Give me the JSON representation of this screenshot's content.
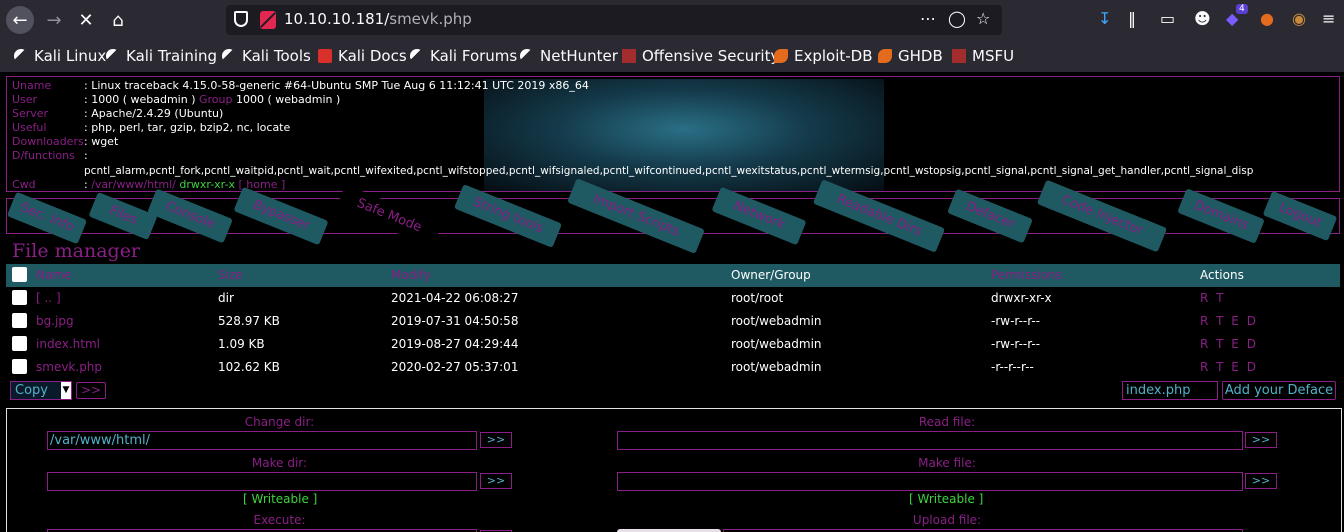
{
  "browser": {
    "url_host": "10.10.10.181/",
    "url_path": "smevk.php",
    "badge_count": "4",
    "bookmarks": [
      "Kali Linux",
      "Kali Training",
      "Kali Tools",
      "Kali Docs",
      "Kali Forums",
      "NetHunter",
      "Offensive Security",
      "Exploit-DB",
      "GHDB",
      "MSFU"
    ]
  },
  "info": {
    "uname_label": "Uname",
    "uname": ": Linux traceback 4.15.0-58-generic #64-Ubuntu SMP Tue Aug 6 11:12:41 UTC 2019 x86_64",
    "user_label": "User",
    "user": ": 1000 ( webadmin )",
    "group_label": "Group",
    "group": "1000 ( webadmin )",
    "server_label": "Server",
    "server": ": Apache/2.4.29 (Ubuntu)",
    "useful_label": "Useful",
    "useful": ": php, perl, tar, gzip, bzip2, nc, locate",
    "downloaders_label": "Downloaders",
    "downloaders": ": wget",
    "dfunctions_label": "D/functions",
    "dfunctions_colon": ":",
    "dfunctions": "pcntl_alarm,pcntl_fork,pcntl_waitpid,pcntl_wait,pcntl_wifexited,pcntl_wifstopped,pcntl_wifsignaled,pcntl_wifcontinued,pcntl_wexitstatus,pcntl_wtermsig,pcntl_wstopsig,pcntl_signal,pcntl_signal_get_handler,pcntl_signal_disp",
    "cwd_label": "Cwd",
    "cwd_colon": ":",
    "cwd_path": "/var/www/html/",
    "cwd_perm": "drwxr-xr-x",
    "cwd_home": "[ home ]"
  },
  "menu": [
    "Sec. Info",
    "Files",
    "Console",
    "Bypasser",
    "Safe Mode",
    "String tools",
    "Import Scripts",
    "Network",
    "Readable Dirs",
    "Defacer",
    "Code Injector",
    "Domains",
    "Logout"
  ],
  "file_manager": {
    "title": "File manager",
    "columns": [
      "Name",
      "Size",
      "Modify",
      "Owner/Group",
      "Permissions",
      "Actions"
    ],
    "rows": [
      {
        "name": "[ .. ]",
        "size": "dir",
        "modify": "2021-04-22 06:08:27",
        "owner": "root/root",
        "perms": "drwxr-xr-x",
        "actions": "R T"
      },
      {
        "name": "bg.jpg",
        "size": "528.97 KB",
        "modify": "2019-07-31 04:50:58",
        "owner": "root/webadmin",
        "perms": "-rw-r--r--",
        "actions": "R T E D"
      },
      {
        "name": "index.html",
        "size": "1.09 KB",
        "modify": "2019-08-27 04:29:44",
        "owner": "root/webadmin",
        "perms": "-rw-r--r--",
        "actions": "R T E D"
      },
      {
        "name": "smevk.php",
        "size": "102.62 KB",
        "modify": "2020-02-27 05:37:01",
        "owner": "root/webadmin",
        "perms": "-r--r--r--",
        "actions": "R T E D"
      }
    ],
    "copy_select": "Copy",
    "go_btn": ">>",
    "deface_file": "index.php",
    "deface_btn": "Add your Deface"
  },
  "tools": {
    "change_dir_label": "Change dir:",
    "change_dir_value": "/var/www/html/",
    "read_file_label": "Read file:",
    "make_dir_label": "Make dir:",
    "make_file_label": "Make file:",
    "writeable_1": "[ Writeable ]",
    "writeable_2": "[ Writeable ]",
    "execute_label": "Execute:",
    "upload_label": "Upload file:",
    "go": ">>"
  }
}
